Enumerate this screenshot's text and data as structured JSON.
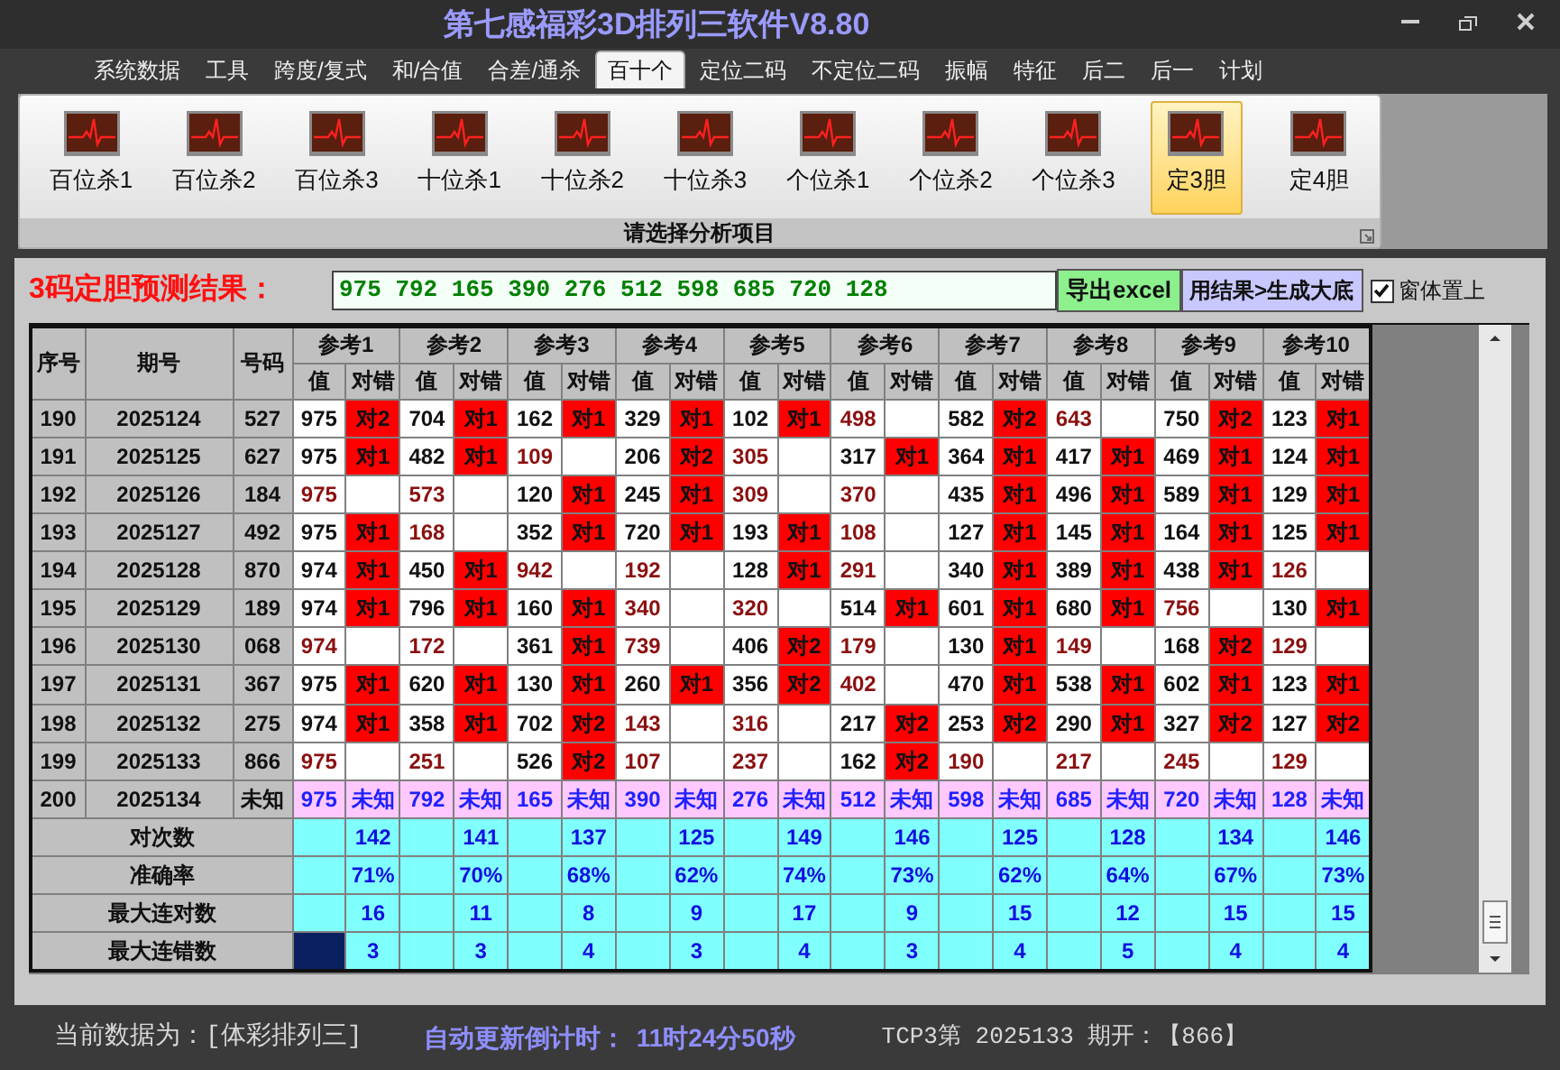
{
  "window": {
    "title": "第七感福彩3D排列三软件V8.80"
  },
  "tabs": [
    {
      "label": "系统数据",
      "selected": false
    },
    {
      "label": "工具",
      "selected": false
    },
    {
      "label": "跨度/复式",
      "selected": false
    },
    {
      "label": "和/合值",
      "selected": false
    },
    {
      "label": "合差/通杀",
      "selected": false
    },
    {
      "label": "百十个",
      "selected": true
    },
    {
      "label": "定位二码",
      "selected": false
    },
    {
      "label": "不定位二码",
      "selected": false
    },
    {
      "label": "振幅",
      "selected": false
    },
    {
      "label": "特征",
      "selected": false
    },
    {
      "label": "后二",
      "selected": false
    },
    {
      "label": "后一",
      "selected": false
    },
    {
      "label": "计划",
      "selected": false
    }
  ],
  "ribbon": {
    "items": [
      {
        "label": "百位杀1",
        "selected": false
      },
      {
        "label": "百位杀2",
        "selected": false
      },
      {
        "label": "百位杀3",
        "selected": false
      },
      {
        "label": "十位杀1",
        "selected": false
      },
      {
        "label": "十位杀2",
        "selected": false
      },
      {
        "label": "十位杀3",
        "selected": false
      },
      {
        "label": "个位杀1",
        "selected": false
      },
      {
        "label": "个位杀2",
        "selected": false
      },
      {
        "label": "个位杀3",
        "selected": false
      },
      {
        "label": "定3胆",
        "selected": true
      },
      {
        "label": "定4胆",
        "selected": false
      }
    ],
    "group_label": "请选择分析项目"
  },
  "prediction": {
    "label": "3码定胆预测结果：",
    "value": "975 792 165 390 276 512 598 685 720 128",
    "buttons": [
      "导出excel",
      "用结果>生成大底"
    ],
    "stay_on_top": {
      "label": "窗体置上",
      "checked": true
    }
  },
  "table": {
    "columns": [
      "序号",
      "期号",
      "号码"
    ],
    "ref_groups": [
      {
        "label": "参考1",
        "subcolumns": [
          "值",
          "对错"
        ]
      },
      {
        "label": "参考2",
        "subcolumns": [
          "值",
          "对错"
        ]
      },
      {
        "label": "参考3",
        "subcolumns": [
          "值",
          "对错"
        ]
      },
      {
        "label": "参考4",
        "subcolumns": [
          "值",
          "对错"
        ]
      },
      {
        "label": "参考5",
        "subcolumns": [
          "值",
          "对错"
        ]
      },
      {
        "label": "参考6",
        "subcolumns": [
          "值",
          "对错"
        ]
      },
      {
        "label": "参考7",
        "subcolumns": [
          "值",
          "对错"
        ]
      },
      {
        "label": "参考8",
        "subcolumns": [
          "值",
          "对错"
        ]
      },
      {
        "label": "参考9",
        "subcolumns": [
          "值",
          "对错"
        ]
      },
      {
        "label": "参考10",
        "subcolumns": [
          "值",
          "对错"
        ]
      }
    ],
    "rows": [
      {
        "kind": "history",
        "seq": "190",
        "issue": "2025124",
        "number": "527",
        "refs": [
          {
            "value": "975",
            "result": "对2"
          },
          {
            "value": "704",
            "result": "对1"
          },
          {
            "value": "162",
            "result": "对1"
          },
          {
            "value": "329",
            "result": "对1"
          },
          {
            "value": "102",
            "result": "对1"
          },
          {
            "value": "498"
          },
          {
            "value": "582",
            "result": "对2"
          },
          {
            "value": "643"
          },
          {
            "value": "750",
            "result": "对2"
          },
          {
            "value": "123",
            "result": "对1"
          }
        ]
      },
      {
        "kind": "history",
        "seq": "191",
        "issue": "2025125",
        "number": "627",
        "refs": [
          {
            "value": "975",
            "result": "对1"
          },
          {
            "value": "482",
            "result": "对1"
          },
          {
            "value": "109"
          },
          {
            "value": "206",
            "result": "对2"
          },
          {
            "value": "305"
          },
          {
            "value": "317",
            "result": "对1"
          },
          {
            "value": "364",
            "result": "对1"
          },
          {
            "value": "417",
            "result": "对1"
          },
          {
            "value": "469",
            "result": "对1"
          },
          {
            "value": "124",
            "result": "对1"
          }
        ]
      },
      {
        "kind": "history",
        "seq": "192",
        "issue": "2025126",
        "number": "184",
        "refs": [
          {
            "value": "975"
          },
          {
            "value": "573"
          },
          {
            "value": "120",
            "result": "对1"
          },
          {
            "value": "245",
            "result": "对1"
          },
          {
            "value": "309"
          },
          {
            "value": "370"
          },
          {
            "value": "435",
            "result": "对1"
          },
          {
            "value": "496",
            "result": "对1"
          },
          {
            "value": "589",
            "result": "对1"
          },
          {
            "value": "129",
            "result": "对1"
          }
        ]
      },
      {
        "kind": "history",
        "seq": "193",
        "issue": "2025127",
        "number": "492",
        "refs": [
          {
            "value": "975",
            "result": "对1"
          },
          {
            "value": "168"
          },
          {
            "value": "352",
            "result": "对1"
          },
          {
            "value": "720",
            "result": "对1"
          },
          {
            "value": "193",
            "result": "对1"
          },
          {
            "value": "108"
          },
          {
            "value": "127",
            "result": "对1"
          },
          {
            "value": "145",
            "result": "对1"
          },
          {
            "value": "164",
            "result": "对1"
          },
          {
            "value": "125",
            "result": "对1"
          }
        ]
      },
      {
        "kind": "history",
        "seq": "194",
        "issue": "2025128",
        "number": "870",
        "refs": [
          {
            "value": "974",
            "result": "对1"
          },
          {
            "value": "450",
            "result": "对1"
          },
          {
            "value": "942"
          },
          {
            "value": "192"
          },
          {
            "value": "128",
            "result": "对1"
          },
          {
            "value": "291"
          },
          {
            "value": "340",
            "result": "对1"
          },
          {
            "value": "389",
            "result": "对1"
          },
          {
            "value": "438",
            "result": "对1"
          },
          {
            "value": "126"
          }
        ]
      },
      {
        "kind": "history",
        "seq": "195",
        "issue": "2025129",
        "number": "189",
        "refs": [
          {
            "value": "974",
            "result": "对1"
          },
          {
            "value": "796",
            "result": "对1"
          },
          {
            "value": "160",
            "result": "对1"
          },
          {
            "value": "340"
          },
          {
            "value": "320"
          },
          {
            "value": "514",
            "result": "对1"
          },
          {
            "value": "601",
            "result": "对1"
          },
          {
            "value": "680",
            "result": "对1"
          },
          {
            "value": "756"
          },
          {
            "value": "130",
            "result": "对1"
          }
        ]
      },
      {
        "kind": "history",
        "seq": "196",
        "issue": "2025130",
        "number": "068",
        "refs": [
          {
            "value": "974"
          },
          {
            "value": "172"
          },
          {
            "value": "361",
            "result": "对1"
          },
          {
            "value": "739"
          },
          {
            "value": "406",
            "result": "对2"
          },
          {
            "value": "179"
          },
          {
            "value": "130",
            "result": "对1"
          },
          {
            "value": "149"
          },
          {
            "value": "168",
            "result": "对2"
          },
          {
            "value": "129"
          }
        ]
      },
      {
        "kind": "history",
        "seq": "197",
        "issue": "2025131",
        "number": "367",
        "refs": [
          {
            "value": "975",
            "result": "对1"
          },
          {
            "value": "620",
            "result": "对1"
          },
          {
            "value": "130",
            "result": "对1"
          },
          {
            "value": "260",
            "result": "对1"
          },
          {
            "value": "356",
            "result": "对2"
          },
          {
            "value": "402"
          },
          {
            "value": "470",
            "result": "对1"
          },
          {
            "value": "538",
            "result": "对1"
          },
          {
            "value": "602",
            "result": "对1"
          },
          {
            "value": "123",
            "result": "对1"
          }
        ]
      },
      {
        "kind": "history",
        "seq": "198",
        "issue": "2025132",
        "number": "275",
        "refs": [
          {
            "value": "974",
            "result": "对1"
          },
          {
            "value": "358",
            "result": "对1"
          },
          {
            "value": "702",
            "result": "对2"
          },
          {
            "value": "143"
          },
          {
            "value": "316"
          },
          {
            "value": "217",
            "result": "对2"
          },
          {
            "value": "253",
            "result": "对2"
          },
          {
            "value": "290",
            "result": "对1"
          },
          {
            "value": "327",
            "result": "对2"
          },
          {
            "value": "127",
            "result": "对2"
          }
        ]
      },
      {
        "kind": "history",
        "seq": "199",
        "issue": "2025133",
        "number": "866",
        "refs": [
          {
            "value": "975"
          },
          {
            "value": "251"
          },
          {
            "value": "526",
            "result": "对2"
          },
          {
            "value": "107"
          },
          {
            "value": "237"
          },
          {
            "value": "162",
            "result": "对2"
          },
          {
            "value": "190"
          },
          {
            "value": "217"
          },
          {
            "value": "245"
          },
          {
            "value": "129"
          }
        ]
      },
      {
        "kind": "pending",
        "seq": "200",
        "issue": "2025134",
        "number": "未知",
        "refs": [
          {
            "value": "975",
            "result": "未知"
          },
          {
            "value": "792",
            "result": "未知"
          },
          {
            "value": "165",
            "result": "未知"
          },
          {
            "value": "390",
            "result": "未知"
          },
          {
            "value": "276",
            "result": "未知"
          },
          {
            "value": "512",
            "result": "未知"
          },
          {
            "value": "598",
            "result": "未知"
          },
          {
            "value": "685",
            "result": "未知"
          },
          {
            "value": "720",
            "result": "未知"
          },
          {
            "value": "128",
            "result": "未知"
          }
        ]
      }
    ],
    "stats": [
      {
        "label": "对次数",
        "values": [
          "142",
          "141",
          "137",
          "125",
          "149",
          "146",
          "125",
          "128",
          "134",
          "146"
        ],
        "focused": false
      },
      {
        "label": "准确率",
        "values": [
          "71%",
          "70%",
          "68%",
          "62%",
          "74%",
          "73%",
          "62%",
          "64%",
          "67%",
          "73%"
        ],
        "focused": false
      },
      {
        "label": "最大连对数",
        "values": [
          "16",
          "11",
          "8",
          "9",
          "17",
          "9",
          "15",
          "12",
          "15",
          "15"
        ],
        "focused": false
      },
      {
        "label": "最大连错数",
        "values": [
          "3",
          "3",
          "4",
          "3",
          "4",
          "3",
          "4",
          "5",
          "4",
          "4"
        ],
        "focused": true
      }
    ]
  },
  "status_bar": {
    "data_source": "当前数据为：[体彩排列三]",
    "countdown_label": "自动更新倒计时：",
    "countdown": "11时24分50秒",
    "latest": "TCP3第 2025133 期开：【866】"
  }
}
